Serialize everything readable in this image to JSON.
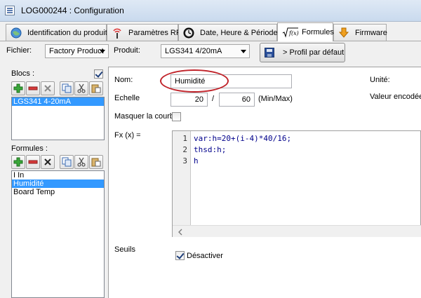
{
  "window": {
    "title": "LOG000244 : Configuration"
  },
  "tabs": [
    {
      "label": "Identification du produit",
      "icon": "globe-icon"
    },
    {
      "label": "Paramètres RF",
      "icon": "antenna-icon"
    },
    {
      "label": "Date, Heure & Périodes",
      "icon": "clock-icon"
    },
    {
      "label": "Formules",
      "icon": "sqrt-fx-icon",
      "active": true
    },
    {
      "label": "Firmware",
      "icon": "download-arrow-icon"
    }
  ],
  "top": {
    "file_label": "Fichier:",
    "file_value": "Factory Product",
    "product_label": "Produit:",
    "product_value": "LGS341 4/20mA",
    "profile_button": "> Profil par défaut"
  },
  "blocs": {
    "label": "Blocs :",
    "checked": true,
    "items": [
      "LGS341 4-20mA"
    ],
    "selected": 0
  },
  "formules": {
    "label": "Formules :",
    "items": [
      "I In",
      "Humidité",
      "Board Temp"
    ],
    "selected": 1
  },
  "form": {
    "name_label": "Nom:",
    "name_value": "Humidité",
    "unit_label": "Unité:",
    "scale_label": "Echelle",
    "scale_min": "20",
    "scale_sep": "/",
    "scale_max": "60",
    "scale_unit": "(Min/Max)",
    "encoded_label": "Valeur encodée",
    "hide_curve_label": "Masquer la courbe",
    "hide_curve_checked": false,
    "fx_label": "Fx (x) =",
    "code_lines": [
      "var:h=20+(i-4)*40/16;",
      "thsd:h;",
      "h"
    ],
    "thresholds_label": "Seuils",
    "disable_label": "Désactiver",
    "disable_checked": true
  },
  "colors": {
    "selection": "#3399ff",
    "highlight_ellipse": "#c0232a",
    "code_text": "#00008b"
  }
}
